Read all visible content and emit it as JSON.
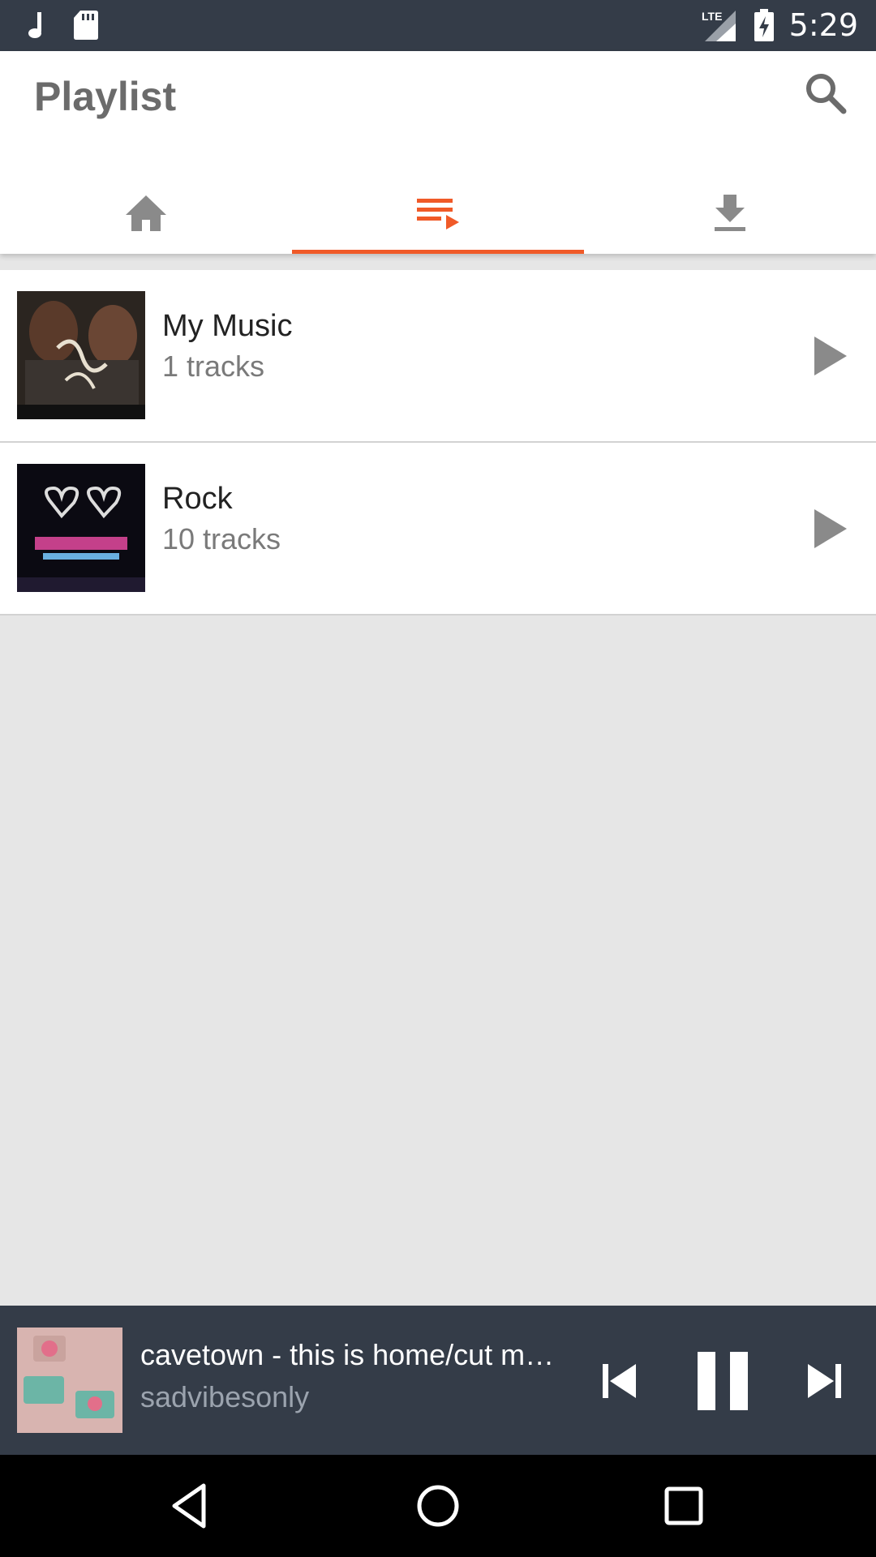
{
  "status_bar": {
    "time": "5:29",
    "left_icons": [
      "music-note-icon",
      "sd-card-icon"
    ],
    "network": "LTE",
    "right_icons": [
      "lte-signal-icon",
      "battery-charging-icon"
    ]
  },
  "app_bar": {
    "title": "Playlist",
    "search_icon": "search-icon"
  },
  "tabs": [
    {
      "icon": "home-icon",
      "active": false
    },
    {
      "icon": "playlist-icon",
      "active": true
    },
    {
      "icon": "download-icon",
      "active": false
    }
  ],
  "playlists": [
    {
      "name": "My Music",
      "count": "1 tracks"
    },
    {
      "name": "Rock",
      "count": "10 tracks"
    }
  ],
  "now_playing": {
    "title": "cavetown - this is home/cut my hair",
    "artist": "sadvibesonly"
  },
  "colors": {
    "accent": "#f05a28",
    "bar": "#343c48",
    "background": "#e6e6e6",
    "icon_grey": "#8a8a8a"
  }
}
